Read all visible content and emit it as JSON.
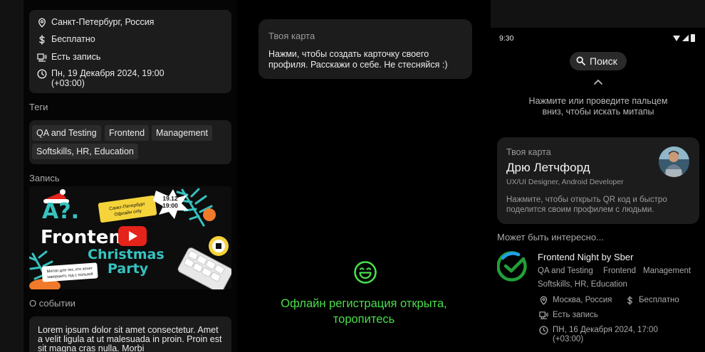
{
  "left": {
    "location": "Санкт-Петербург, Россия",
    "price": "Бесплатно",
    "recording": "Есть запись",
    "datetime_line1": "Пн, 19 Декабря 2024, 19:00",
    "datetime_line2": "(+03:00)",
    "tags_title": "Теги",
    "tags": [
      "QA and Testing",
      "Frontend",
      "Management",
      "Softskills, HR, Education"
    ],
    "recording_title": "Запись",
    "banner": {
      "top_text": "A?.",
      "main_text": "Frontend",
      "sub_text_1": "Christmas",
      "sub_text_2": "Party",
      "sticker_city_1": "Санкт-Петербург",
      "sticker_city_2": "Офлайн only",
      "sticker_date_1": "19.12",
      "sticker_date_2": "19:00",
      "sticker_note_1": "Митап для тех, кто хочет",
      "sticker_note_2": "завершить год с пользой"
    },
    "about_title": "О событии",
    "about_text": "Lorem ipsum dolor sit amet consectetur. Amet a velit ligula at ut malesuada in proin. Proin est sit magna cras nulla. Morbi"
  },
  "middle": {
    "card_title": "Твоя карта",
    "card_text": "Нажми, чтобы создать карточку своего профиля. Расскажи о себе. Не стесняйся :)",
    "offline_line1": "Офлайн регистрация открыта,",
    "offline_line2": "торопитесь"
  },
  "phone": {
    "status_time": "9:30",
    "search_label": "Поиск",
    "pull_hint": "Нажмите или проведите пальцем вниз, чтобы искать митапы",
    "card_label": "Твоя карта",
    "name": "Дрю Летчфорд",
    "role": "UX/UI Designer, Android Developer",
    "card_hint": "Нажмите, чтобы открыть QR код и быстро поделится своим профилем с людьми.",
    "maybe_label": "Может быть интересно...",
    "event": {
      "title": "Frontend Night by Sber",
      "tags": [
        "QA and Testing",
        "Frontend",
        "Management",
        "Softskills, HR, Education"
      ],
      "location": "Москва, Россия",
      "price": "Бесплатно",
      "recording": "Есть запись",
      "datetime_line1": "ПН, 16 Декабря 2024, 17:00",
      "datetime_line2": "(+03:00)"
    }
  },
  "colors": {
    "background": "#000000",
    "card": "#1c1c1c",
    "chip": "#2c2c2c",
    "accent_green": "#4ade4a",
    "youtube_red": "#e4231b",
    "banner_bg": "#0d0d0d"
  },
  "icons": [
    "location-pin-icon",
    "dollar-icon",
    "recording-icon",
    "clock-icon",
    "search-icon",
    "chevron-up-icon",
    "smile-icon",
    "youtube-play-icon",
    "sber-logo-icon"
  ]
}
